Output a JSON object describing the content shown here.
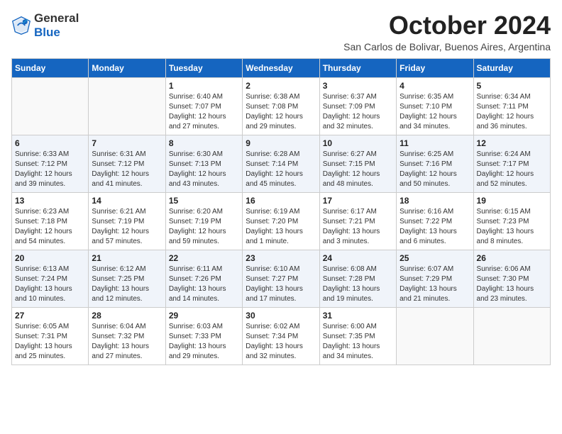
{
  "header": {
    "logo_general": "General",
    "logo_blue": "Blue",
    "month_title": "October 2024",
    "subtitle": "San Carlos de Bolivar, Buenos Aires, Argentina"
  },
  "weekdays": [
    "Sunday",
    "Monday",
    "Tuesday",
    "Wednesday",
    "Thursday",
    "Friday",
    "Saturday"
  ],
  "weeks": [
    [
      {
        "day": "",
        "info": ""
      },
      {
        "day": "",
        "info": ""
      },
      {
        "day": "1",
        "info": "Sunrise: 6:40 AM\nSunset: 7:07 PM\nDaylight: 12 hours and 27 minutes."
      },
      {
        "day": "2",
        "info": "Sunrise: 6:38 AM\nSunset: 7:08 PM\nDaylight: 12 hours and 29 minutes."
      },
      {
        "day": "3",
        "info": "Sunrise: 6:37 AM\nSunset: 7:09 PM\nDaylight: 12 hours and 32 minutes."
      },
      {
        "day": "4",
        "info": "Sunrise: 6:35 AM\nSunset: 7:10 PM\nDaylight: 12 hours and 34 minutes."
      },
      {
        "day": "5",
        "info": "Sunrise: 6:34 AM\nSunset: 7:11 PM\nDaylight: 12 hours and 36 minutes."
      }
    ],
    [
      {
        "day": "6",
        "info": "Sunrise: 6:33 AM\nSunset: 7:12 PM\nDaylight: 12 hours and 39 minutes."
      },
      {
        "day": "7",
        "info": "Sunrise: 6:31 AM\nSunset: 7:12 PM\nDaylight: 12 hours and 41 minutes."
      },
      {
        "day": "8",
        "info": "Sunrise: 6:30 AM\nSunset: 7:13 PM\nDaylight: 12 hours and 43 minutes."
      },
      {
        "day": "9",
        "info": "Sunrise: 6:28 AM\nSunset: 7:14 PM\nDaylight: 12 hours and 45 minutes."
      },
      {
        "day": "10",
        "info": "Sunrise: 6:27 AM\nSunset: 7:15 PM\nDaylight: 12 hours and 48 minutes."
      },
      {
        "day": "11",
        "info": "Sunrise: 6:25 AM\nSunset: 7:16 PM\nDaylight: 12 hours and 50 minutes."
      },
      {
        "day": "12",
        "info": "Sunrise: 6:24 AM\nSunset: 7:17 PM\nDaylight: 12 hours and 52 minutes."
      }
    ],
    [
      {
        "day": "13",
        "info": "Sunrise: 6:23 AM\nSunset: 7:18 PM\nDaylight: 12 hours and 54 minutes."
      },
      {
        "day": "14",
        "info": "Sunrise: 6:21 AM\nSunset: 7:19 PM\nDaylight: 12 hours and 57 minutes."
      },
      {
        "day": "15",
        "info": "Sunrise: 6:20 AM\nSunset: 7:19 PM\nDaylight: 12 hours and 59 minutes."
      },
      {
        "day": "16",
        "info": "Sunrise: 6:19 AM\nSunset: 7:20 PM\nDaylight: 13 hours and 1 minute."
      },
      {
        "day": "17",
        "info": "Sunrise: 6:17 AM\nSunset: 7:21 PM\nDaylight: 13 hours and 3 minutes."
      },
      {
        "day": "18",
        "info": "Sunrise: 6:16 AM\nSunset: 7:22 PM\nDaylight: 13 hours and 6 minutes."
      },
      {
        "day": "19",
        "info": "Sunrise: 6:15 AM\nSunset: 7:23 PM\nDaylight: 13 hours and 8 minutes."
      }
    ],
    [
      {
        "day": "20",
        "info": "Sunrise: 6:13 AM\nSunset: 7:24 PM\nDaylight: 13 hours and 10 minutes."
      },
      {
        "day": "21",
        "info": "Sunrise: 6:12 AM\nSunset: 7:25 PM\nDaylight: 13 hours and 12 minutes."
      },
      {
        "day": "22",
        "info": "Sunrise: 6:11 AM\nSunset: 7:26 PM\nDaylight: 13 hours and 14 minutes."
      },
      {
        "day": "23",
        "info": "Sunrise: 6:10 AM\nSunset: 7:27 PM\nDaylight: 13 hours and 17 minutes."
      },
      {
        "day": "24",
        "info": "Sunrise: 6:08 AM\nSunset: 7:28 PM\nDaylight: 13 hours and 19 minutes."
      },
      {
        "day": "25",
        "info": "Sunrise: 6:07 AM\nSunset: 7:29 PM\nDaylight: 13 hours and 21 minutes."
      },
      {
        "day": "26",
        "info": "Sunrise: 6:06 AM\nSunset: 7:30 PM\nDaylight: 13 hours and 23 minutes."
      }
    ],
    [
      {
        "day": "27",
        "info": "Sunrise: 6:05 AM\nSunset: 7:31 PM\nDaylight: 13 hours and 25 minutes."
      },
      {
        "day": "28",
        "info": "Sunrise: 6:04 AM\nSunset: 7:32 PM\nDaylight: 13 hours and 27 minutes."
      },
      {
        "day": "29",
        "info": "Sunrise: 6:03 AM\nSunset: 7:33 PM\nDaylight: 13 hours and 29 minutes."
      },
      {
        "day": "30",
        "info": "Sunrise: 6:02 AM\nSunset: 7:34 PM\nDaylight: 13 hours and 32 minutes."
      },
      {
        "day": "31",
        "info": "Sunrise: 6:00 AM\nSunset: 7:35 PM\nDaylight: 13 hours and 34 minutes."
      },
      {
        "day": "",
        "info": ""
      },
      {
        "day": "",
        "info": ""
      }
    ]
  ]
}
